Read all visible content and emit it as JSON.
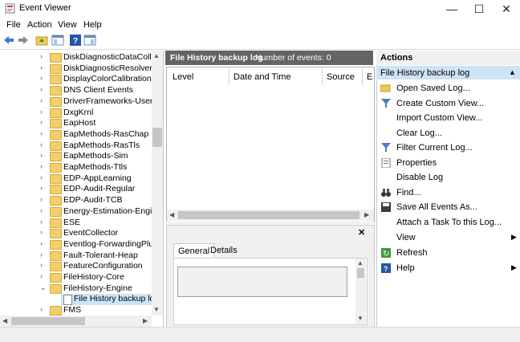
{
  "window": {
    "title": "Event Viewer",
    "minimize": "—",
    "maximize": "☐",
    "close": "✕"
  },
  "menu": [
    "File",
    "Action",
    "View",
    "Help"
  ],
  "tree": {
    "items": [
      {
        "label": "DiskDiagnosticDataCollecto",
        "type": "folder"
      },
      {
        "label": "DiskDiagnosticResolver",
        "type": "folder"
      },
      {
        "label": "DisplayColorCalibration",
        "type": "folder"
      },
      {
        "label": "DNS Client Events",
        "type": "folder"
      },
      {
        "label": "DriverFrameworks-UserMod",
        "type": "folder"
      },
      {
        "label": "DxgKrnl",
        "type": "folder"
      },
      {
        "label": "EapHost",
        "type": "folder"
      },
      {
        "label": "EapMethods-RasChap",
        "type": "folder"
      },
      {
        "label": "EapMethods-RasTls",
        "type": "folder"
      },
      {
        "label": "EapMethods-Sim",
        "type": "folder"
      },
      {
        "label": "EapMethods-Ttls",
        "type": "folder"
      },
      {
        "label": "EDP-AppLearning",
        "type": "folder"
      },
      {
        "label": "EDP-Audit-Regular",
        "type": "folder"
      },
      {
        "label": "EDP-Audit-TCB",
        "type": "folder"
      },
      {
        "label": "Energy-Estimation-Engine",
        "type": "folder"
      },
      {
        "label": "ESE",
        "type": "folder"
      },
      {
        "label": "EventCollector",
        "type": "folder"
      },
      {
        "label": "Eventlog-ForwardingPlugin",
        "type": "folder"
      },
      {
        "label": "Fault-Tolerant-Heap",
        "type": "folder"
      },
      {
        "label": "FeatureConfiguration",
        "type": "folder"
      },
      {
        "label": "FileHistory-Core",
        "type": "folder"
      },
      {
        "label": "FileHistory-Engine",
        "type": "folder-open"
      },
      {
        "label": "File History backup log",
        "type": "log"
      },
      {
        "label": "FMS",
        "type": "folder"
      }
    ]
  },
  "log": {
    "name": "File History backup log",
    "events_label": "Number of events: 0"
  },
  "grid": {
    "columns": [
      "Level",
      "Date and Time",
      "Source",
      "E"
    ]
  },
  "detail": {
    "close": "✕",
    "tabs": [
      "General",
      "Details"
    ]
  },
  "actions": {
    "header": "Actions",
    "section": "File History backup log",
    "items": [
      {
        "label": "Open Saved Log...",
        "icon": "folder-open-icon"
      },
      {
        "label": "Create Custom View...",
        "icon": "filter-icon"
      },
      {
        "label": "Import Custom View...",
        "icon": ""
      },
      {
        "label": "Clear Log...",
        "icon": ""
      },
      {
        "label": "Filter Current Log...",
        "icon": "filter-icon"
      },
      {
        "label": "Properties",
        "icon": "properties-icon"
      },
      {
        "label": "Disable Log",
        "icon": ""
      },
      {
        "label": "Find...",
        "icon": "binoculars-icon"
      },
      {
        "label": "Save All Events As...",
        "icon": "save-icon"
      },
      {
        "label": "Attach a Task To this Log...",
        "icon": ""
      },
      {
        "label": "View",
        "icon": "",
        "submenu": true
      },
      {
        "label": "Refresh",
        "icon": "refresh-icon"
      },
      {
        "label": "Help",
        "icon": "help-icon",
        "submenu": true
      }
    ]
  }
}
